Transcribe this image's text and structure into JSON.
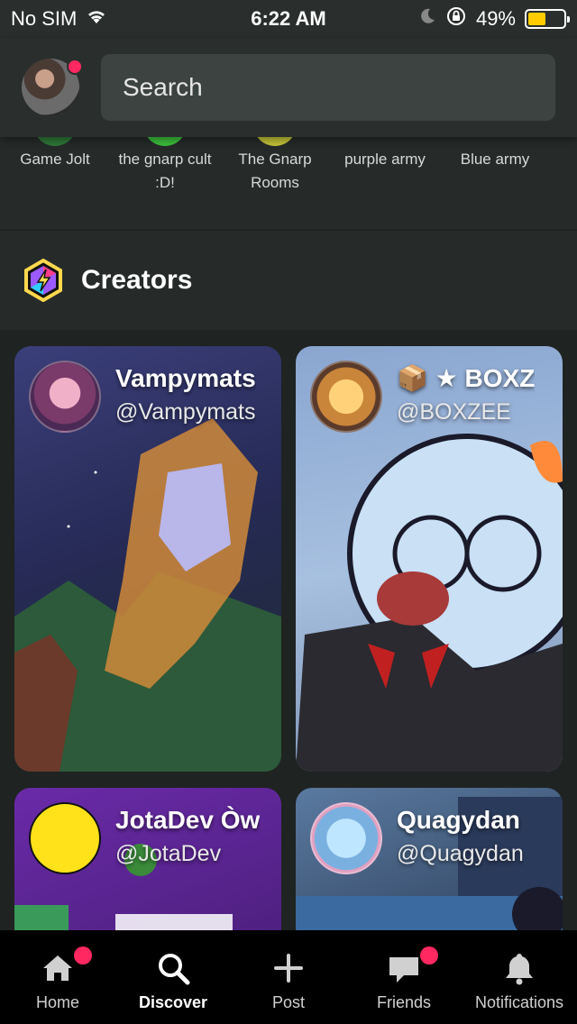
{
  "status_bar": {
    "carrier": "No SIM",
    "time": "6:22 AM",
    "battery_percent": "49%",
    "battery_level": 0.49,
    "icons": [
      "wifi-icon",
      "moon-icon",
      "rotation-lock-icon",
      "battery-icon"
    ]
  },
  "header": {
    "avatar_icon": "user-avatar",
    "search_placeholder": "Search"
  },
  "communities": [
    {
      "label": "Game Jolt",
      "color": "#2f7a3a"
    },
    {
      "label": "the gnarp cult :D!",
      "color": "#3ec43e"
    },
    {
      "label": "The Gnarp Rooms",
      "color": "#c8c83a"
    },
    {
      "label": "purple army",
      "color": "#2a2f2d"
    },
    {
      "label": "Blue army",
      "color": "#2a2f2d"
    }
  ],
  "creators": {
    "title": "Creators",
    "icon": "creators-hex-icon",
    "cards": [
      {
        "name": "Vampymats",
        "handle": "@Vampymats",
        "bg": "#2b2f5c"
      },
      {
        "name": "📦 ★ BOXZ",
        "handle": "@BOXZEE",
        "bg": "#8fa7c9"
      },
      {
        "name": "JotaDev Òw",
        "handle": "@JotaDev",
        "bg": "#5b2a8f"
      },
      {
        "name": "Quagydan",
        "handle": "@Quagydan",
        "bg": "#3a5f8a"
      }
    ]
  },
  "nav": {
    "items": [
      {
        "label": "Home",
        "icon": "home-icon",
        "badge": true,
        "active": false
      },
      {
        "label": "Discover",
        "icon": "search-icon",
        "badge": false,
        "active": true
      },
      {
        "label": "Post",
        "icon": "plus-icon",
        "badge": false,
        "active": false
      },
      {
        "label": "Friends",
        "icon": "chat-icon",
        "badge": true,
        "active": false
      },
      {
        "label": "Notifications",
        "icon": "bell-icon",
        "badge": false,
        "active": false
      }
    ]
  },
  "colors": {
    "badge": "#ff2860",
    "battery": "#ffcc00"
  }
}
